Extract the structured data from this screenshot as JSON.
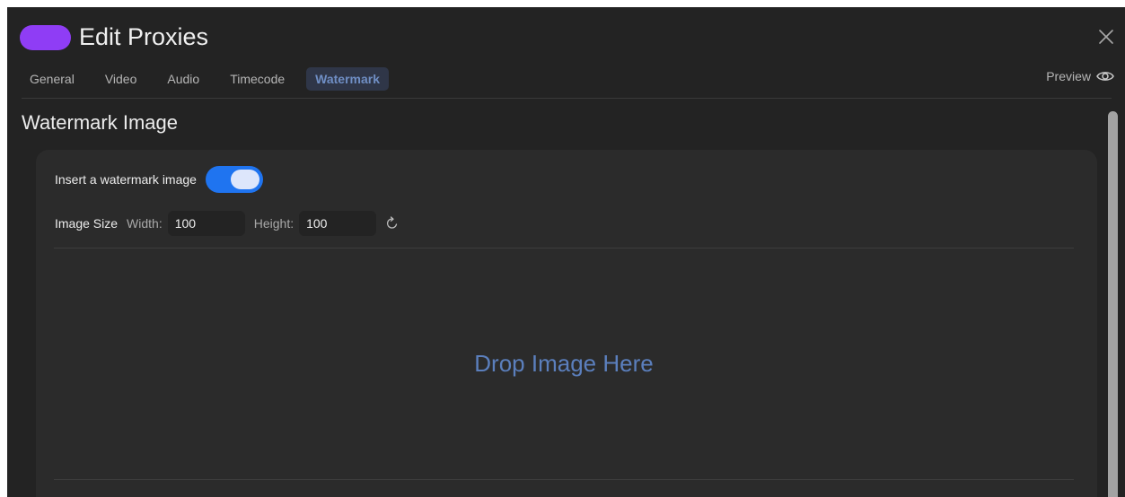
{
  "window": {
    "title": "Edit Proxies"
  },
  "tabs": [
    {
      "label": "General",
      "active": false
    },
    {
      "label": "Video",
      "active": false
    },
    {
      "label": "Audio",
      "active": false
    },
    {
      "label": "Timecode",
      "active": false
    },
    {
      "label": "Watermark",
      "active": true
    }
  ],
  "preview": {
    "label": "Preview",
    "icon": "eye-icon"
  },
  "section": {
    "title": "Watermark Image"
  },
  "watermark": {
    "insert_label": "Insert a watermark image",
    "insert_enabled": true,
    "image_size_label": "Image Size",
    "width_label": "Width:",
    "width_value": "100",
    "height_label": "Height:",
    "height_value": "100",
    "reset_icon": "reset-icon",
    "drop_text": "Drop Image Here"
  },
  "colors": {
    "accent": "#1f74f0",
    "app_pill": "#8f3df5",
    "active_tab_text": "#6f8ec4",
    "drop_text": "#5b7fbd"
  }
}
